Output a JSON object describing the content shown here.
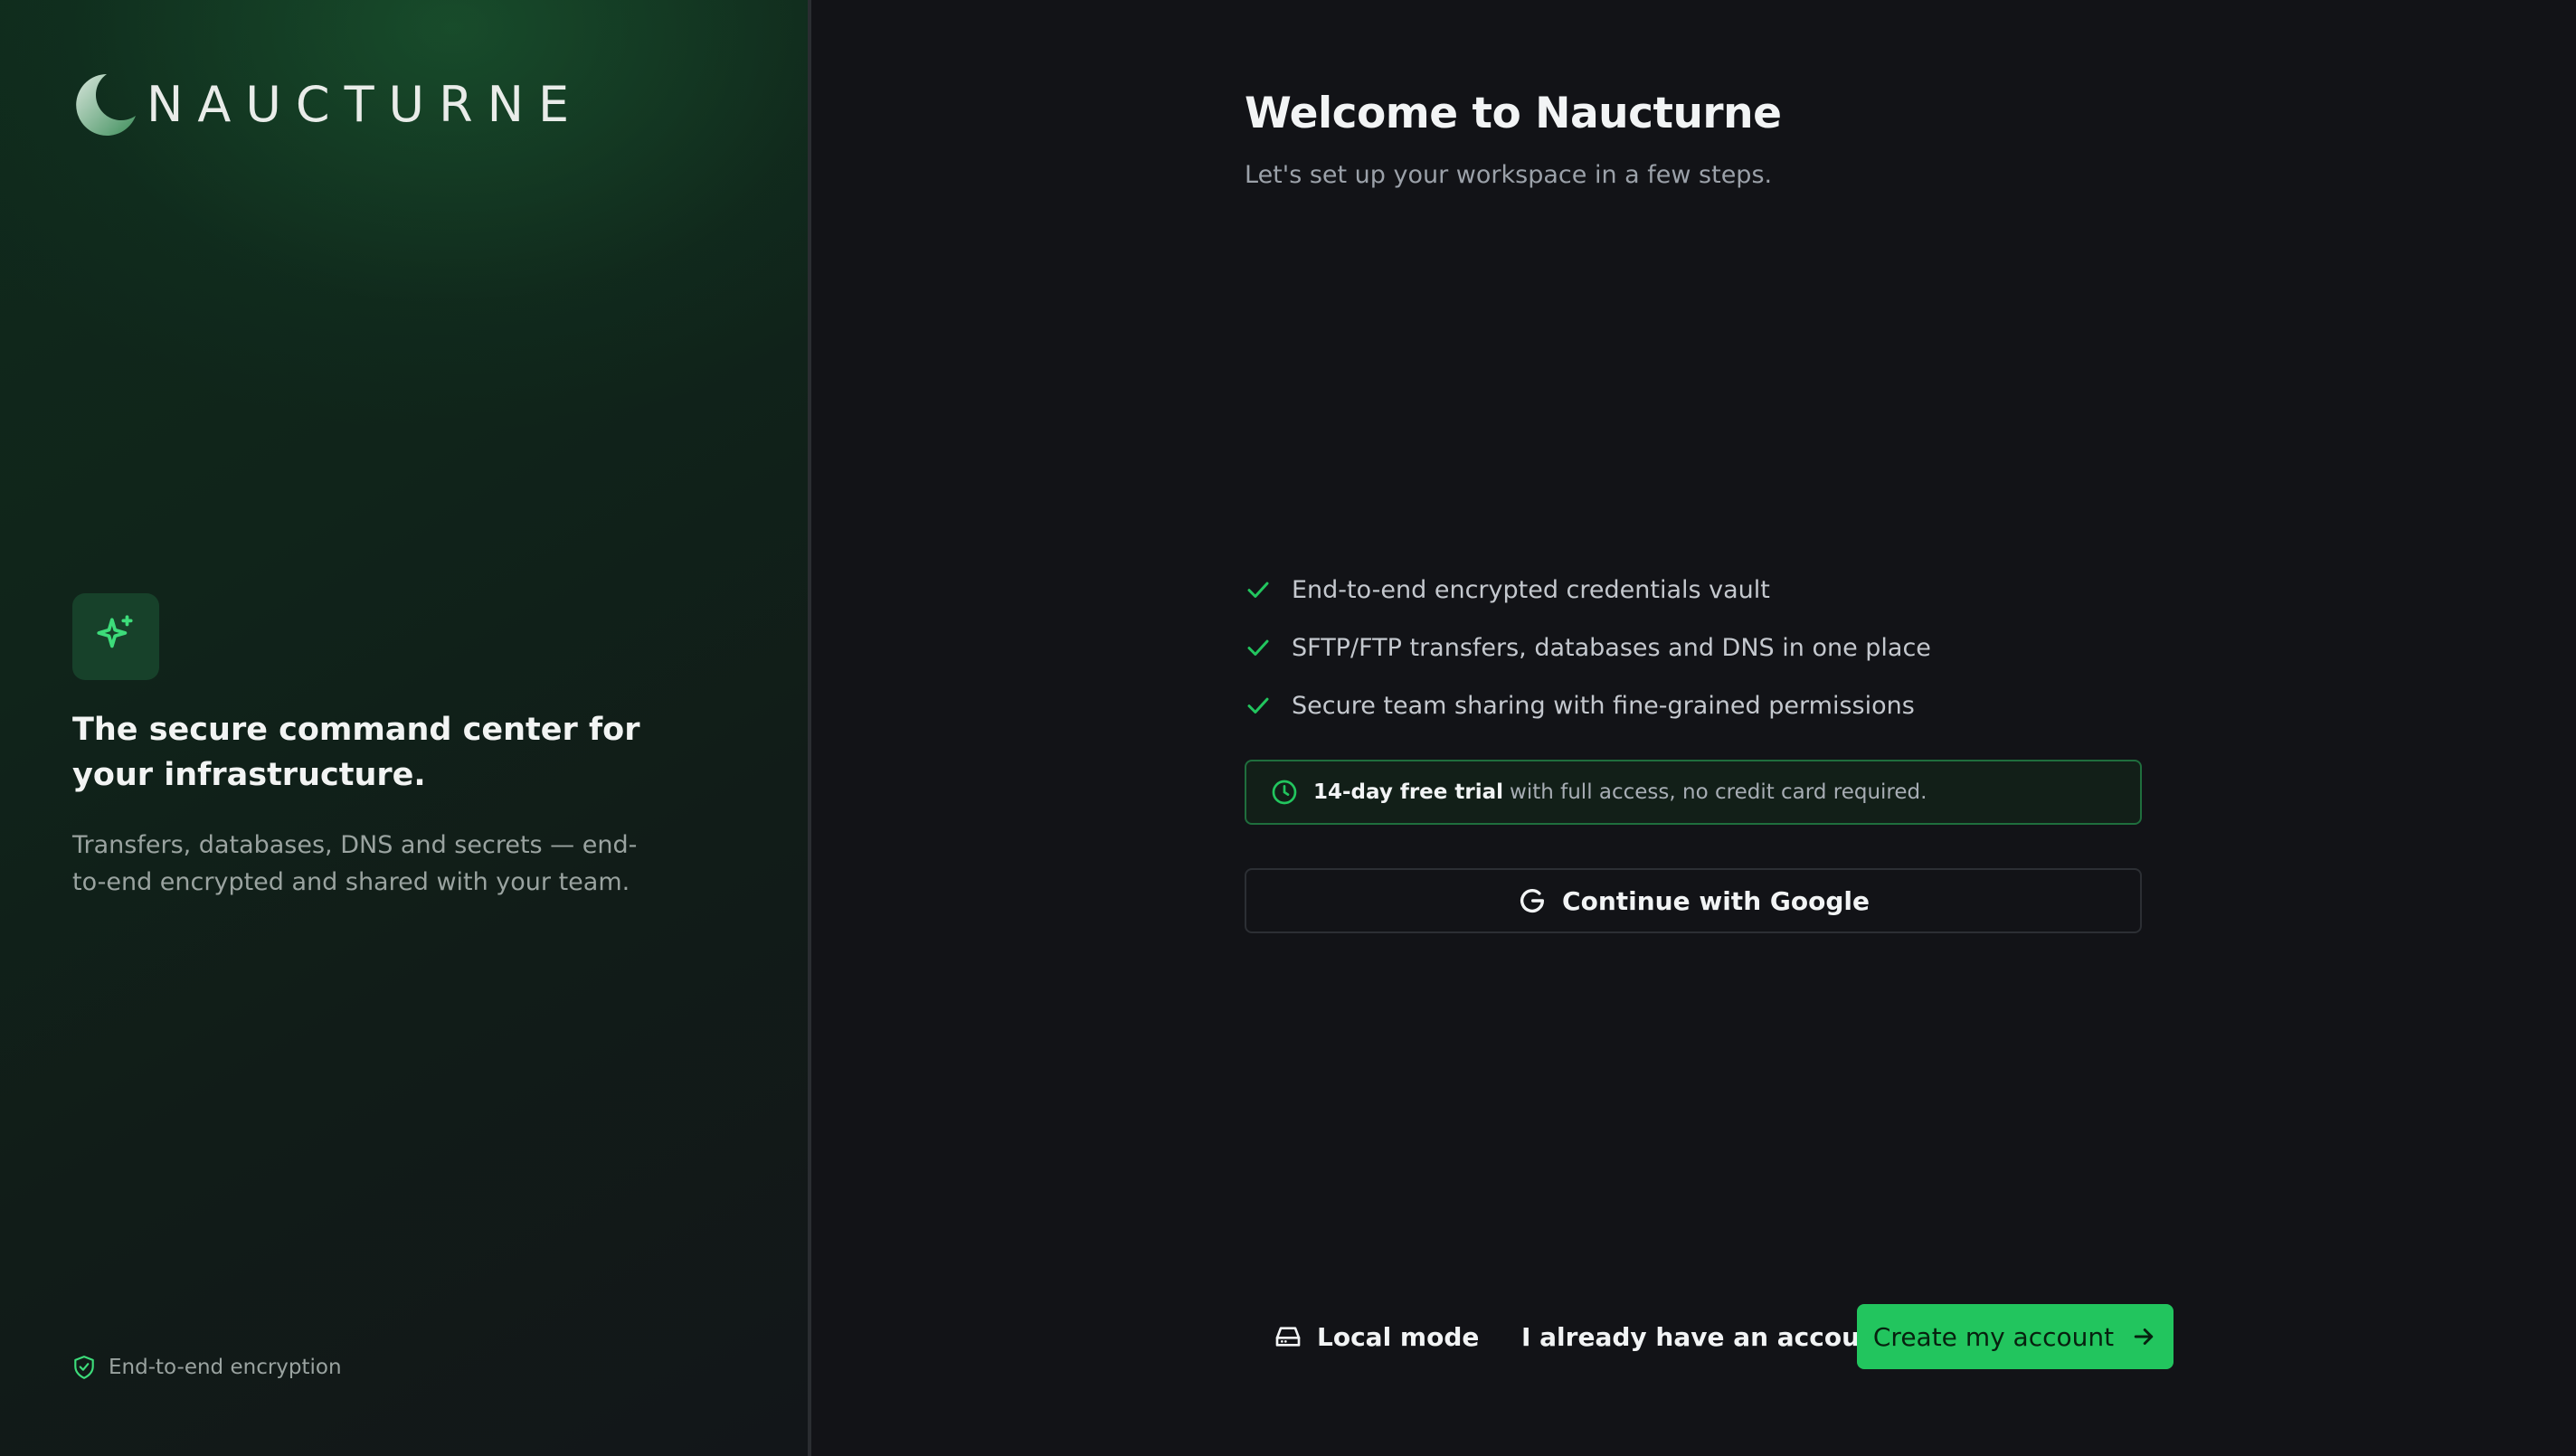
{
  "brand": {
    "name": "NAUCTURNE",
    "accent_color": "#22c55e",
    "logo_icon": "crescent-moon-icon"
  },
  "left": {
    "feature_icon": "sparkle-icon",
    "headline": "The secure command center for your infrastructure.",
    "description": "Transfers, databases, DNS and secrets — end-to-end encrypted and shared with your team.",
    "footer_icon": "shield-check-icon",
    "footer_text": "End-to-end encryption"
  },
  "main": {
    "title": "Welcome to Naucturne",
    "subtitle": "Let's set up your workspace in a few steps.",
    "features": [
      "End-to-end encrypted credentials vault",
      "SFTP/FTP transfers, databases and DNS in one place",
      "Secure team sharing with fine-grained permissions"
    ],
    "trial": {
      "icon": "clock-icon",
      "bold": "14-day free trial",
      "rest": "with full access, no credit card required."
    },
    "google_button": {
      "icon": "google-g-icon",
      "label": "Continue with Google"
    }
  },
  "actions": {
    "local_mode": {
      "icon": "hard-drive-icon",
      "label": "Local mode"
    },
    "have_account": "I already have an account",
    "create_account": {
      "label": "Create my account",
      "icon": "arrow-right-icon"
    }
  }
}
